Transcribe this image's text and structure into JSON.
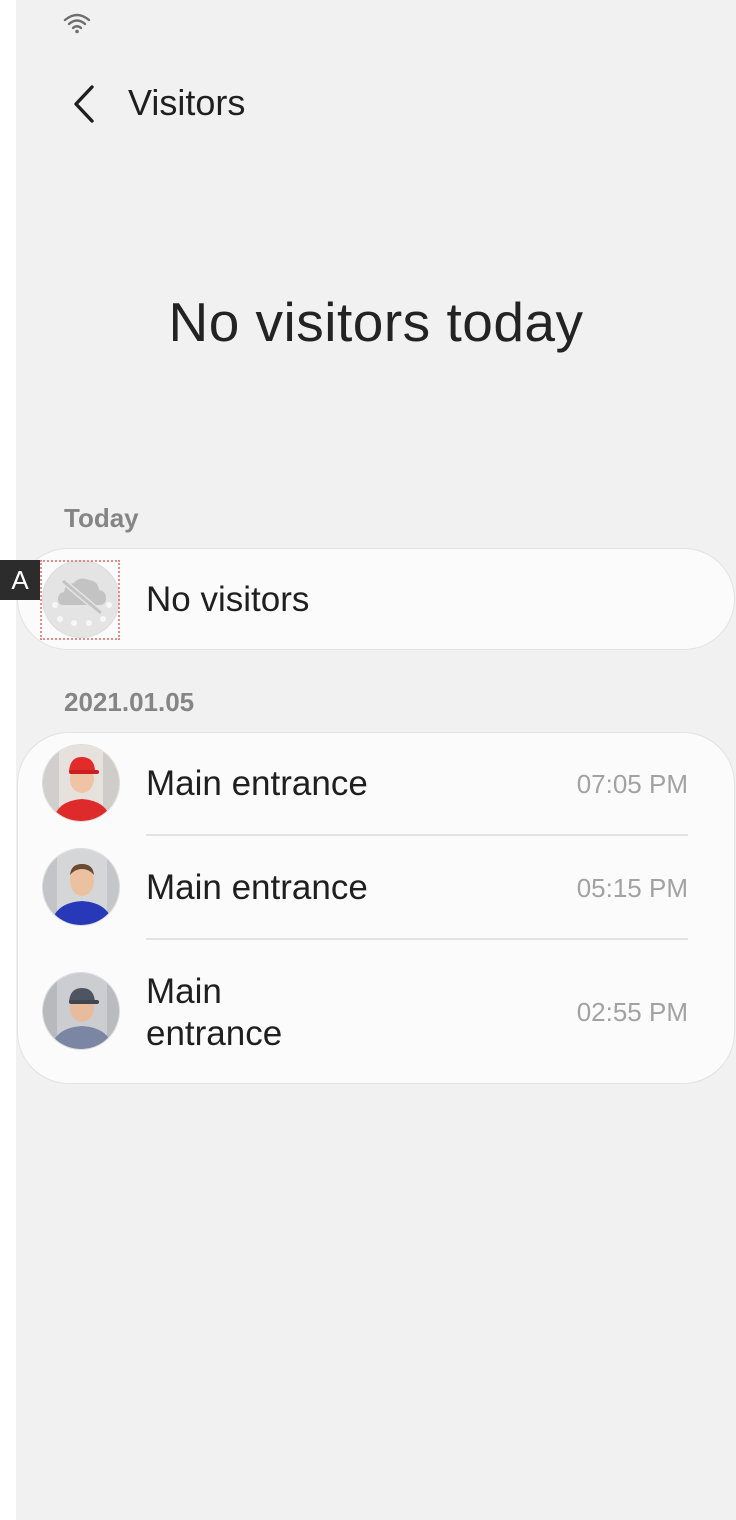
{
  "header": {
    "title": "Visitors"
  },
  "empty_state": {
    "message": "No visitors today"
  },
  "today": {
    "label": "Today",
    "empty_text": "No visitors"
  },
  "history": {
    "date": "2021.01.05",
    "items": [
      {
        "location": "Main entrance",
        "time": "07:05 PM"
      },
      {
        "location": "Main entrance",
        "time": "05:15 PM"
      },
      {
        "location": "Main\nentrance",
        "time": "02:55 PM"
      }
    ]
  },
  "annotation": {
    "marker": "A"
  },
  "icons": {
    "back": "chevron-left-icon",
    "wifi": "wifi-icon",
    "no_visitors": "cloud-off-icon"
  },
  "colors": {
    "background": "#f1f1f1",
    "card": "#fbfbfb",
    "text": "#1f1f1f",
    "muted": "#858585",
    "time": "#a2a2a2"
  }
}
